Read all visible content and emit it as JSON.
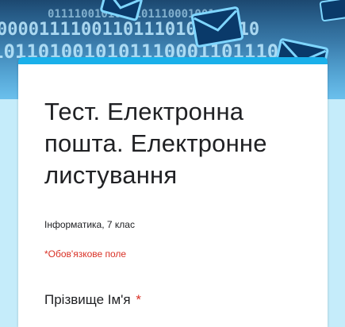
{
  "form": {
    "title": "Тест. Електронна пошта. Електронне листування",
    "description": "Інформатика, 7 клас",
    "required_note": "*Обов'язкове поле",
    "questions": [
      {
        "label": "Прізвище Ім'я",
        "required_mark": "*"
      }
    ]
  },
  "header_image": {
    "binary_rows": [
      "0000111100110111010001010",
      "1011010010101110001101110",
      "0111100101010101110001001"
    ],
    "icon": "envelope-icon"
  },
  "colors": {
    "accent": "#1ab0ea",
    "required": "#d93025",
    "page_background": "#c5ecfa",
    "text": "#202124"
  }
}
